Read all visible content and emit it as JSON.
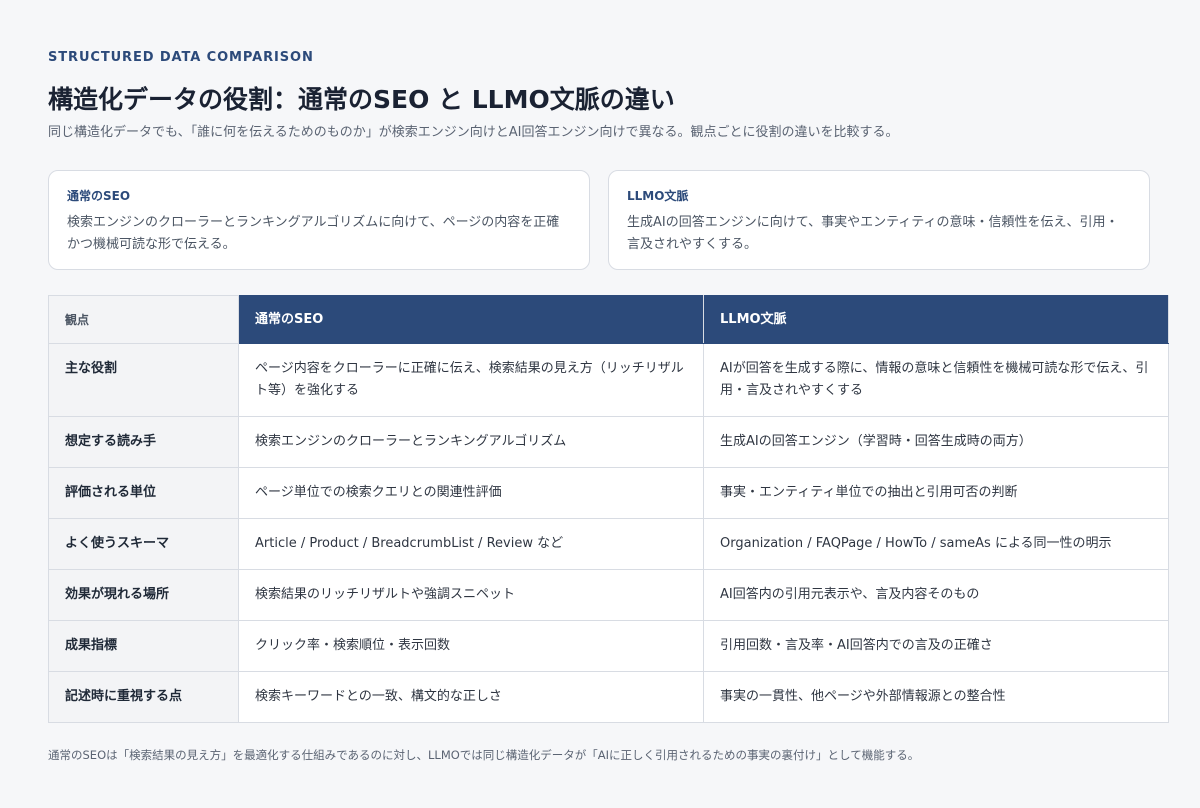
{
  "header": {
    "eyebrow": "STRUCTURED DATA COMPARISON",
    "title": "構造化データの役割：通常のSEO と LLMO文脈の違い",
    "subtitle": "同じ構造化データでも、「誰に何を伝えるためのものか」が検索エンジン向けとAI回答エンジン向けで異なる。観点ごとに役割の違いを比較する。"
  },
  "cards": [
    {
      "title": "通常のSEO",
      "desc": "検索エンジンのクローラーとランキングアルゴリズムに向けて、ページの内容を正確かつ機械可読な形で伝える。"
    },
    {
      "title": "LLMO文脈",
      "desc": "生成AIの回答エンジンに向けて、事実やエンティティの意味・信頼性を伝え、引用・言及されやすくする。"
    }
  ],
  "table": {
    "headers": [
      "観点",
      "通常のSEO",
      "LLMO文脈"
    ],
    "rows": [
      {
        "aspect": "主な役割",
        "seo": "ページ内容をクローラーに正確に伝え、検索結果の見え方（リッチリザルト等）を強化する",
        "llmo": "AIが回答を生成する際に、情報の意味と信頼性を機械可読な形で伝え、引用・言及されやすくする"
      },
      {
        "aspect": "想定する読み手",
        "seo": "検索エンジンのクローラーとランキングアルゴリズム",
        "llmo": "生成AIの回答エンジン（学習時・回答生成時の両方）"
      },
      {
        "aspect": "評価される単位",
        "seo": "ページ単位での検索クエリとの関連性評価",
        "llmo": "事実・エンティティ単位での抽出と引用可否の判断"
      },
      {
        "aspect": "よく使うスキーマ",
        "seo": "Article / Product / BreadcrumbList / Review など",
        "llmo": "Organization / FAQPage / HowTo / sameAs による同一性の明示"
      },
      {
        "aspect": "効果が現れる場所",
        "seo": "検索結果のリッチリザルトや強調スニペット",
        "llmo": "AI回答内の引用元表示や、言及内容そのもの"
      },
      {
        "aspect": "成果指標",
        "seo": "クリック率・検索順位・表示回数",
        "llmo": "引用回数・言及率・AI回答内での言及の正確さ"
      },
      {
        "aspect": "記述時に重視する点",
        "seo": "検索キーワードとの一致、構文的な正しさ",
        "llmo": "事実の一貫性、他ページや外部情報源との整合性"
      }
    ]
  },
  "footnote": "通常のSEOは「検索結果の見え方」を最適化する仕組みであるのに対し、LLMOでは同じ構造化データが「AIに正しく引用されるための事実の裏付け」として機能する。"
}
